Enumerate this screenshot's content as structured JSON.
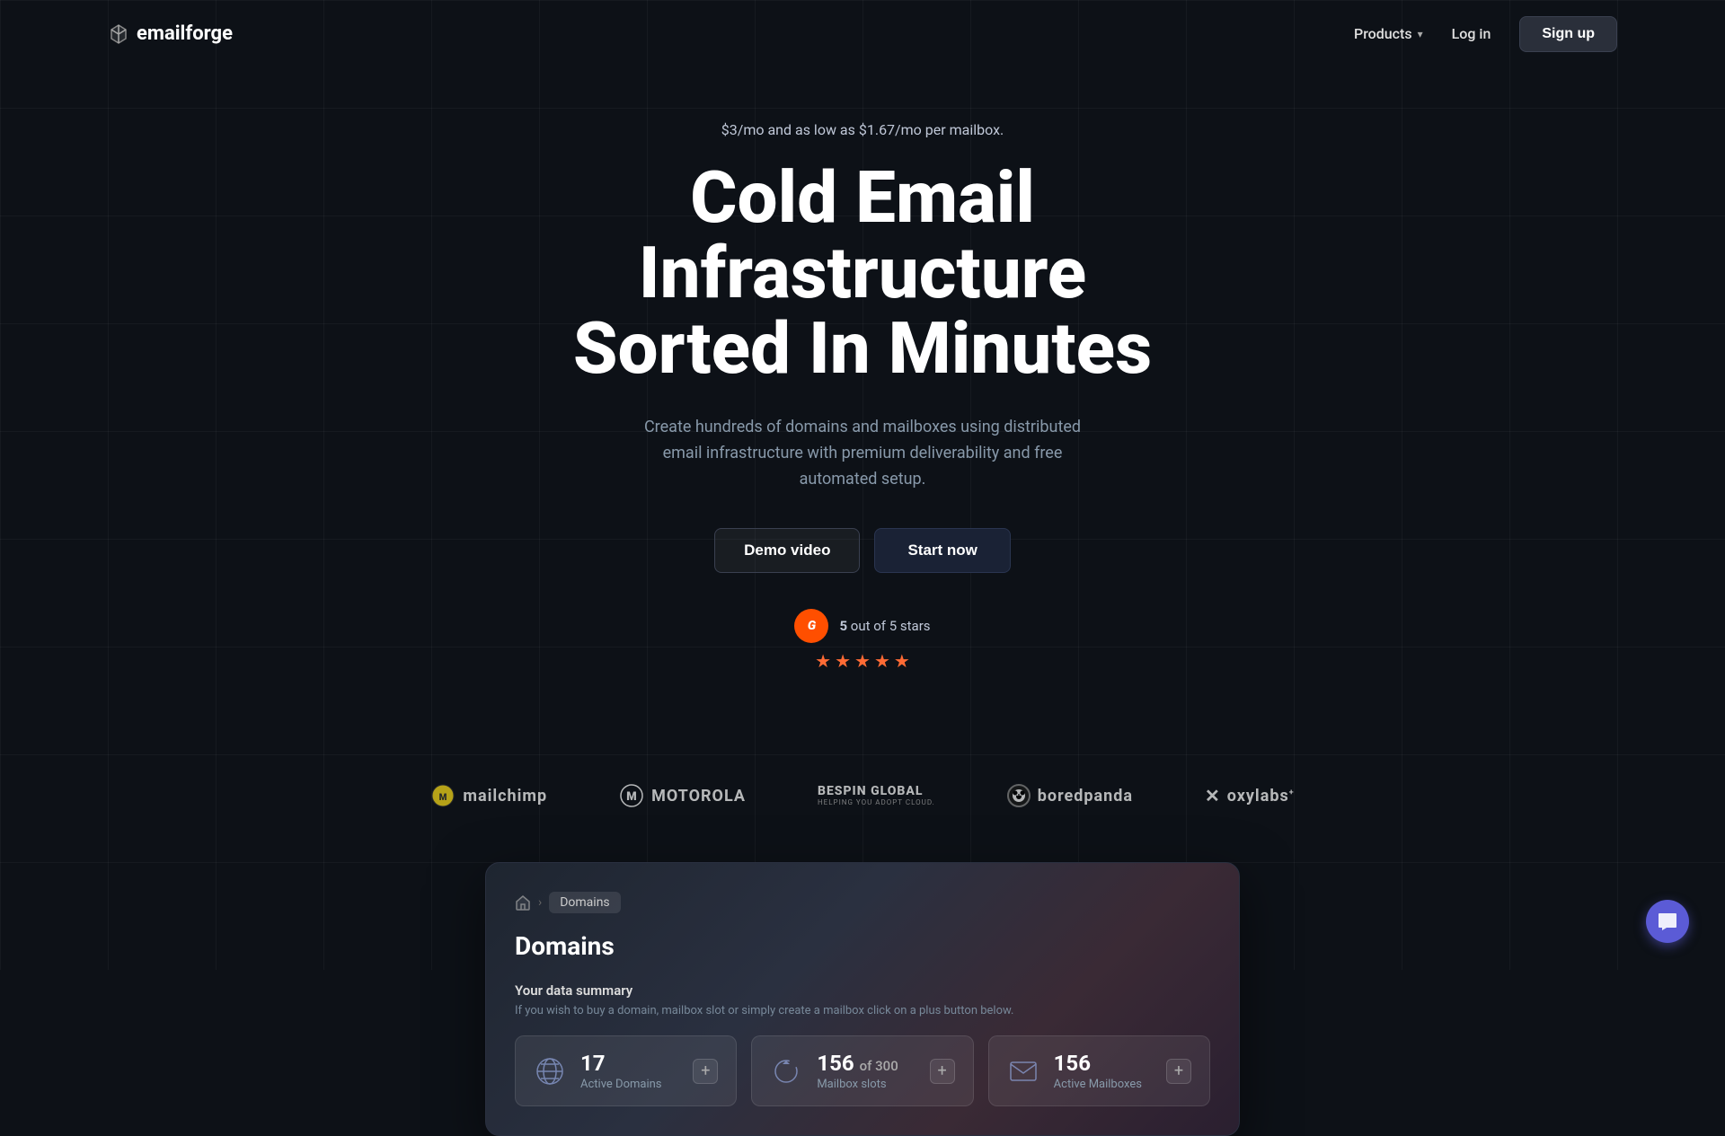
{
  "nav": {
    "logo_text": "emailforge",
    "products_label": "Products",
    "login_label": "Log in",
    "signup_label": "Sign up"
  },
  "hero": {
    "pricing_text": "$3/mo and as low as $1.67/mo per mailbox.",
    "title_line1": "Cold Email Infrastructure",
    "title_line2": "Sorted In Minutes",
    "subtitle": "Create hundreds of domains and mailboxes using distributed email infrastructure with premium deliverability and free automated setup.",
    "demo_button": "Demo video",
    "start_button": "Start now"
  },
  "rating": {
    "g2_label": "G",
    "score": "5",
    "text": "out of 5 stars",
    "stars": [
      "★",
      "★",
      "★",
      "★",
      "★"
    ]
  },
  "partners": [
    {
      "name": "mailchimp",
      "icon": "M",
      "text": "mailchimp"
    },
    {
      "name": "motorola",
      "icon": "M",
      "text": "MOTOROLA"
    },
    {
      "name": "bespin_global",
      "main": "BESPIN GLOBAL",
      "sub": "HELPING YOU ADOPT CLOUD."
    },
    {
      "name": "boredpanda",
      "text": "boredpanda"
    },
    {
      "name": "oxylabs",
      "text": "oxylabs"
    }
  ],
  "dashboard": {
    "breadcrumb_home": "🏠",
    "breadcrumb_sep": "›",
    "breadcrumb_item": "Domains",
    "title": "Domains",
    "summary_label": "Your data summary",
    "summary_desc": "If you wish to buy a domain, mailbox slot or simply create a mailbox click on a plus button below.",
    "stats": [
      {
        "id": "active_domains",
        "number": "17",
        "label": "Active Domains",
        "icon_type": "globe"
      },
      {
        "id": "mailbox_slots",
        "number": "156",
        "number_suffix": "of 300",
        "label": "Mailbox slots",
        "icon_type": "refresh"
      },
      {
        "id": "active_mailboxes",
        "number": "156",
        "label": "Active Mailboxes",
        "icon_type": "mail"
      }
    ]
  },
  "chat": {
    "icon": "💬"
  }
}
